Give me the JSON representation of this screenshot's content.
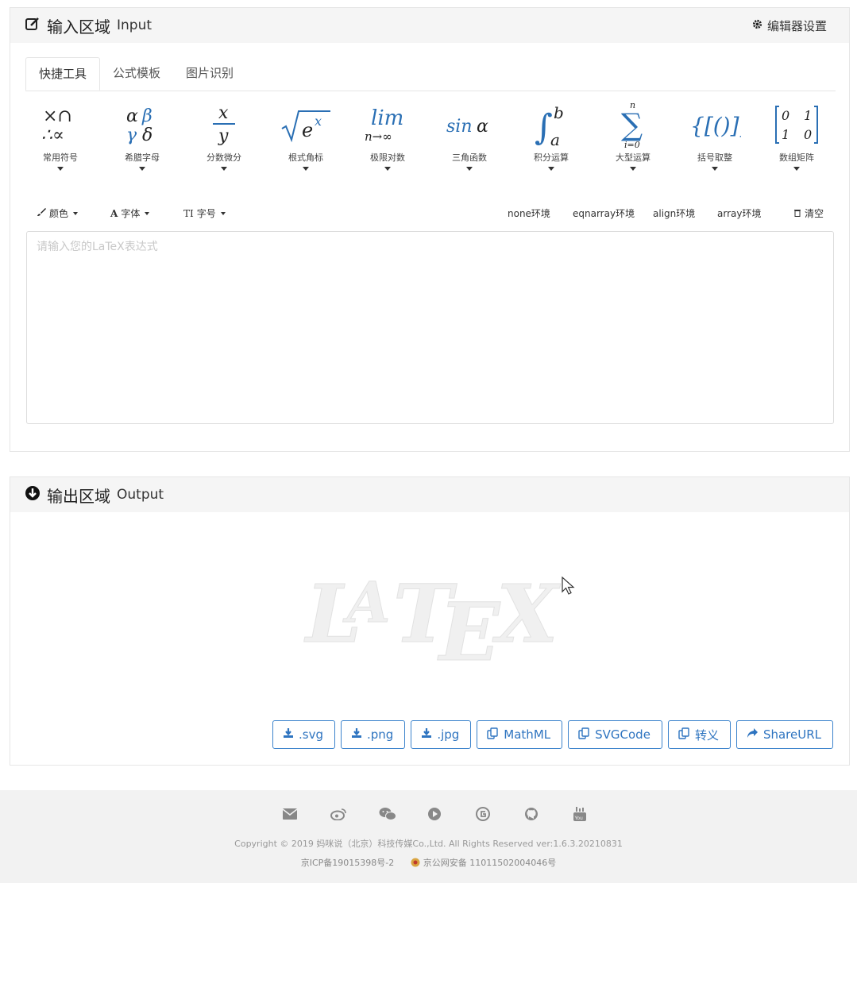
{
  "input": {
    "title_cn": "输入区域",
    "title_en": "Input",
    "settings_label": "编辑器设置",
    "tabs": [
      {
        "label": "快捷工具",
        "active": true
      },
      {
        "label": "公式模板",
        "active": false
      },
      {
        "label": "图片识别",
        "active": false
      }
    ],
    "tools": [
      {
        "label": "常用符号",
        "icon": "symbols"
      },
      {
        "label": "希腊字母",
        "icon": "greek"
      },
      {
        "label": "分数微分",
        "icon": "fraction"
      },
      {
        "label": "根式角标",
        "icon": "root"
      },
      {
        "label": "极限对数",
        "icon": "limit"
      },
      {
        "label": "三角函数",
        "icon": "trig"
      },
      {
        "label": "积分运算",
        "icon": "integral"
      },
      {
        "label": "大型运算",
        "icon": "sum"
      },
      {
        "label": "括号取整",
        "icon": "brackets"
      },
      {
        "label": "数组矩阵",
        "icon": "matrix"
      }
    ],
    "format_tools": {
      "color": "颜色",
      "font": "字体",
      "size": "字号",
      "none_env": "none环境",
      "eqnarray_env": "eqnarray环境",
      "align_env": "align环境",
      "array_env": "array环境",
      "clear": "清空"
    },
    "editor_placeholder": "请输入您的LaTeX表达式"
  },
  "output": {
    "title_cn": "输出区域",
    "title_en": "Output",
    "buttons": [
      {
        "label": ".svg",
        "icon": "download-icon"
      },
      {
        "label": ".png",
        "icon": "download-icon"
      },
      {
        "label": ".jpg",
        "icon": "download-icon"
      },
      {
        "label": "MathML",
        "icon": "copy-icon"
      },
      {
        "label": "SVGCode",
        "icon": "copy-icon"
      },
      {
        "label": "转义",
        "icon": "copy-icon"
      },
      {
        "label": "ShareURL",
        "icon": "share-icon"
      }
    ]
  },
  "footer": {
    "icons": [
      "email-icon",
      "weibo-icon",
      "wechat-icon",
      "video-icon",
      "circle-g-icon",
      "github-icon",
      "youtube-icon"
    ],
    "copyright": "Copyright © 2019 妈咪说（北京）科技传媒Co.,Ltd. All Rights Reserved  ver:1.6.3.20210831",
    "icp": "京ICP备19015398号-2",
    "police": "京公网安备 11011502004046号"
  },
  "colors": {
    "accent": "#2e74c0",
    "panel_head": "#f5f5f5",
    "footer_bg": "#f2f2f2"
  }
}
